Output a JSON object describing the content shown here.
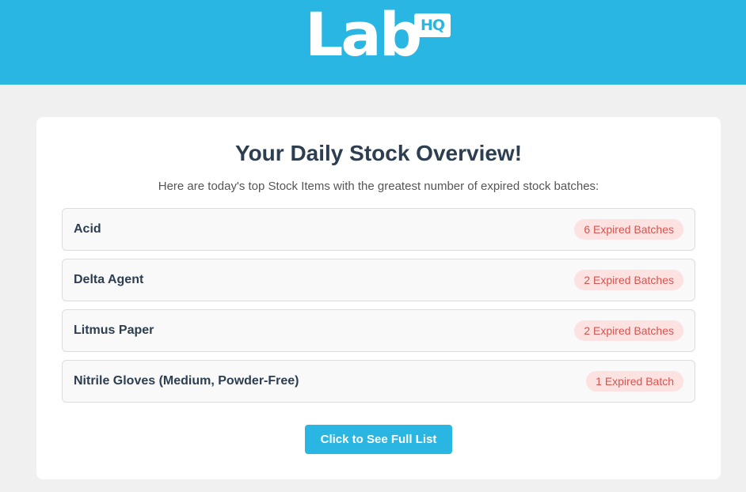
{
  "header": {
    "logo_text": "Lab",
    "logo_badge": "HQ",
    "background_color": "#29b6e3"
  },
  "card": {
    "title": "Your Daily Stock Overview!",
    "subtitle": "Here are today's top Stock Items with the greatest number of expired stock batches:",
    "items": [
      {
        "name": "Acid",
        "badge": "6 Expired Batches"
      },
      {
        "name": "Delta Agent",
        "badge": "2 Expired Batches"
      },
      {
        "name": "Litmus Paper",
        "badge": "2 Expired Batches"
      },
      {
        "name": "Nitrile Gloves (Medium, Powder-Free)",
        "badge": "1 Expired Batch"
      }
    ],
    "button_label": "Click to See Full List"
  },
  "colors": {
    "accent": "#29b6e3",
    "title_text": "#2c3e50",
    "badge_background": "#fde2e2",
    "badge_text": "#d9534f",
    "page_background": "#f0f0f0"
  }
}
